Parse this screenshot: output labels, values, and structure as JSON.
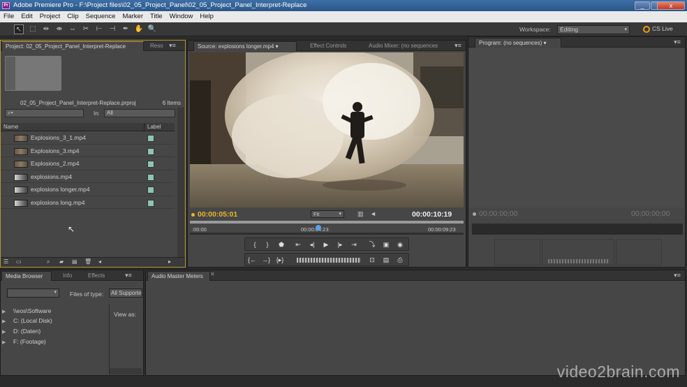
{
  "window": {
    "title": "Adobe Premiere Pro - F:\\Project files\\02_05_Project_Panel\\02_05_Project_Panel_Interpret-Replace",
    "logo": "Pr",
    "controls": {
      "minimize": "_",
      "maximize": "▫",
      "close": "x"
    }
  },
  "menu": [
    "File",
    "Edit",
    "Project",
    "Clip",
    "Sequence",
    "Marker",
    "Title",
    "Window",
    "Help"
  ],
  "toolbar": {
    "tools": [
      {
        "name": "selection-tool",
        "glyph": "↖"
      },
      {
        "name": "track-select-tool",
        "glyph": "⬚"
      },
      {
        "name": "ripple-edit-tool",
        "glyph": "⇹"
      },
      {
        "name": "rolling-edit-tool",
        "glyph": "⇼"
      },
      {
        "name": "rate-stretch-tool",
        "glyph": "⇔"
      },
      {
        "name": "razor-tool",
        "glyph": "✂"
      },
      {
        "name": "slip-tool",
        "glyph": "⊢"
      },
      {
        "name": "slide-tool",
        "glyph": "⊣"
      },
      {
        "name": "pen-tool",
        "glyph": "✒"
      },
      {
        "name": "hand-tool",
        "glyph": "✋"
      },
      {
        "name": "zoom-tool",
        "glyph": "🔍"
      }
    ],
    "workspace_label": "Workspace:",
    "workspace_value": "Editing",
    "cs_live": "CS Live"
  },
  "project_panel": {
    "tabs": [
      "Project: 02_05_Project_Panel_Interpret-Replace",
      "Reso"
    ],
    "file": "02_05_Project_Panel_Interpret-Replace.prproj",
    "count": "6 Items",
    "in_label": "In:",
    "in_value": "All",
    "columns": {
      "name": "Name",
      "label": "Label"
    },
    "items": [
      {
        "name": "Explosions_3_1.mp4",
        "thumb": "dark"
      },
      {
        "name": "Explosions_3.mp4",
        "thumb": "dark"
      },
      {
        "name": "Explosions_2.mp4",
        "thumb": "dark"
      },
      {
        "name": "explosions.mp4",
        "thumb": "light"
      },
      {
        "name": "explosions longer.mp4",
        "thumb": "light"
      },
      {
        "name": "explosions long.mp4",
        "thumb": "light"
      }
    ],
    "label_color": "#8fc4b2"
  },
  "source_monitor": {
    "tabs": [
      "Source: explosions longer.mp4",
      "Effect Controls",
      "Audio Mixer: (no sequences"
    ],
    "timecode_current": "00:00:05:01",
    "fit": "Fit",
    "timecode_duration": "00:00:10:19",
    "ruler": {
      "start": ":00:00",
      "mid": "00:00:04:23",
      "end": "00:00:09:23"
    },
    "playhead_progress": 0.47
  },
  "program_monitor": {
    "tab": "Program: (no sequences)",
    "timecode_left": "00;00;00;00",
    "timecode_right": "00;00;00;00"
  },
  "media_browser": {
    "tabs": [
      "Media Browser",
      "Info",
      "Effects"
    ],
    "files_of_type_label": "Files of type:",
    "files_of_type_value": "All Supported",
    "view_as_label": "View as:",
    "tree": [
      "\\\\eos\\Software",
      "C: (Local Disk)",
      "D: (Daten)",
      "F: (Footage)"
    ]
  },
  "audio_meters": {
    "tab": "Audio Master Meters"
  },
  "colors": {
    "accent_timecode": "#e8b82a",
    "panel": "#464646",
    "title_bar": "#2a5688"
  }
}
